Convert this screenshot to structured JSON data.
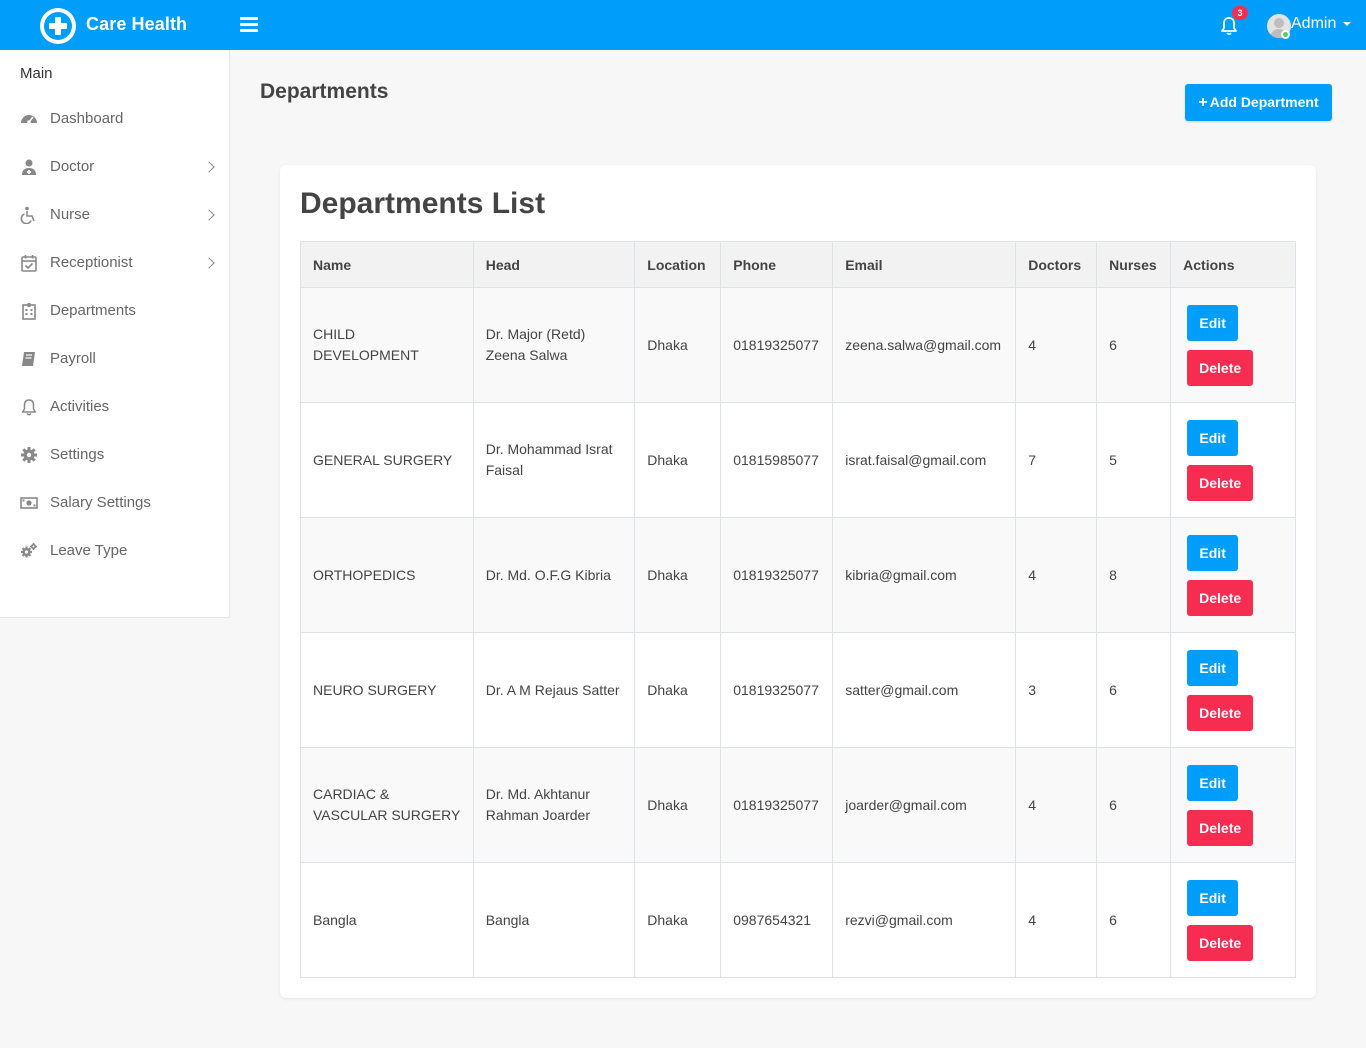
{
  "header": {
    "brand": "Care Health",
    "notification_count": "3",
    "user_name": "Admin"
  },
  "sidebar": {
    "menu_title": "Main",
    "items": [
      {
        "label": "Dashboard",
        "icon": "dashboard-icon",
        "has_submenu": false
      },
      {
        "label": "Doctor",
        "icon": "doctor-icon",
        "has_submenu": true
      },
      {
        "label": "Nurse",
        "icon": "wheelchair-icon",
        "has_submenu": true
      },
      {
        "label": "Receptionist",
        "icon": "calendar-check-icon",
        "has_submenu": true
      },
      {
        "label": "Departments",
        "icon": "hospital-icon",
        "has_submenu": false
      },
      {
        "label": "Payroll",
        "icon": "book-icon",
        "has_submenu": false
      },
      {
        "label": "Activities",
        "icon": "bell-icon",
        "has_submenu": false
      },
      {
        "label": "Settings",
        "icon": "gear-icon",
        "has_submenu": false
      },
      {
        "label": "Salary Settings",
        "icon": "money-icon",
        "has_submenu": false
      },
      {
        "label": "Leave Type",
        "icon": "gears-icon",
        "has_submenu": false
      }
    ]
  },
  "page": {
    "title": "Departments",
    "add_button": "Add Department"
  },
  "card": {
    "title": "Departments List"
  },
  "table": {
    "headers": [
      "Name",
      "Head",
      "Location",
      "Phone",
      "Email",
      "Doctors",
      "Nurses",
      "Actions"
    ],
    "edit_label": "Edit",
    "delete_label": "Delete",
    "rows": [
      {
        "name": "CHILD DEVELOPMENT",
        "head": "Dr. Major (Retd) Zeena Salwa",
        "location": "Dhaka",
        "phone": "01819325077",
        "email": "zeena.salwa@gmail.com",
        "doctors": "4",
        "nurses": "6"
      },
      {
        "name": "GENERAL SURGERY",
        "head": "Dr. Mohammad Israt Faisal",
        "location": "Dhaka",
        "phone": "01815985077",
        "email": "israt.faisal@gmail.com",
        "doctors": "7",
        "nurses": "5"
      },
      {
        "name": "ORTHOPEDICS",
        "head": "Dr. Md. O.F.G Kibria",
        "location": "Dhaka",
        "phone": "01819325077",
        "email": "kibria@gmail.com",
        "doctors": "4",
        "nurses": "8"
      },
      {
        "name": "NEURO SURGERY",
        "head": "Dr. A M Rejaus Satter",
        "location": "Dhaka",
        "phone": "01819325077",
        "email": "satter@gmail.com",
        "doctors": "3",
        "nurses": "6"
      },
      {
        "name": "CARDIAC & VASCULAR SURGERY",
        "head": "Dr. Md. Akhtanur Rahman Joarder",
        "location": "Dhaka",
        "phone": "01819325077",
        "email": "joarder@gmail.com",
        "doctors": "4",
        "nurses": "6"
      },
      {
        "name": "Bangla",
        "head": "Bangla",
        "location": "Dhaka",
        "phone": "0987654321",
        "email": "rezvi@gmail.com",
        "doctors": "4",
        "nurses": "6"
      }
    ]
  },
  "colors": {
    "primary": "#009efb",
    "danger": "#f62d51",
    "online": "#55ce63"
  }
}
